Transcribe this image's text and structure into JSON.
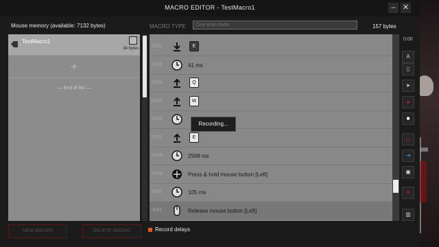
{
  "window": {
    "title": "MACRO EDITOR - TestMacro1"
  },
  "left": {
    "memory_label": "Mouse memory (available: 7132 bytes)",
    "macro": {
      "name": "TestMacro1",
      "size": "34 bytes"
    },
    "add_symbol": "+",
    "end_of_list": "— End of list —"
  },
  "header": {
    "type_label": "MACRO TYPE",
    "type_placeholder": "One-time mode",
    "bytes": "157 bytes"
  },
  "rows": [
    {
      "num": "0052",
      "icon": "key-down-icon",
      "key": "E",
      "dark": true
    },
    {
      "num": "0053",
      "icon": "clock-icon",
      "text": "41 ms"
    },
    {
      "num": "0054",
      "icon": "key-up-icon",
      "key": "Q"
    },
    {
      "num": "0055",
      "icon": "key-up-icon",
      "key": "W"
    },
    {
      "num": "0056",
      "icon": "clock-icon",
      "text": ""
    },
    {
      "num": "0057",
      "icon": "key-up-icon",
      "key": "E"
    },
    {
      "num": "0058",
      "icon": "clock-icon",
      "text": "2568 ms"
    },
    {
      "num": "0059",
      "icon": "mouse-hold-icon",
      "text": "Press & hold mouse button [Left]"
    },
    {
      "num": "0060",
      "icon": "clock-icon",
      "text": "105 ms"
    },
    {
      "num": "0061",
      "icon": "mouse-release-icon",
      "text": "Release mouse button [Left]"
    }
  ],
  "popup": "Recording...",
  "toolbar": {
    "timer": "0:00"
  },
  "bottom": {
    "new_macro": "NEW MACRO",
    "delete_macro": "DELETE MACRO",
    "record_delays": "Record delays"
  },
  "colors": {
    "accent": "#e3581f",
    "danger": "#c42020"
  }
}
